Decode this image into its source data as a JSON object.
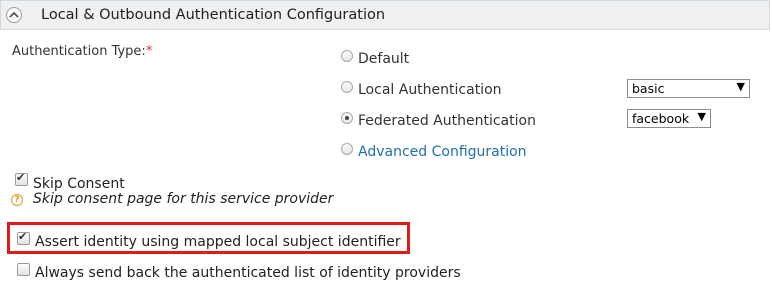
{
  "section": {
    "title": "Local & Outbound Authentication Configuration"
  },
  "auth_type": {
    "label": "Authentication Type:",
    "required_mark": "*",
    "options": [
      {
        "label": "Default",
        "selected": false
      },
      {
        "label": "Local Authentication",
        "selected": false
      },
      {
        "label": "Federated Authentication",
        "selected": true
      },
      {
        "label": "Advanced Configuration",
        "selected": false,
        "is_link": true
      }
    ],
    "local_select": {
      "value": "basic"
    },
    "federated_select": {
      "value": "facebook"
    }
  },
  "skip_consent": {
    "label": "Skip Consent",
    "checked": true,
    "help": "Skip consent page for this service provider"
  },
  "assert_identity": {
    "label": "Assert identity using mapped local subject identifier",
    "checked": true,
    "highlighted": true
  },
  "send_back": {
    "label": "Always send back the authenticated list of identity providers",
    "checked": false
  },
  "colors": {
    "highlight": "#e11b1b",
    "link": "#1f6fb2",
    "required": "#d32f2f"
  }
}
